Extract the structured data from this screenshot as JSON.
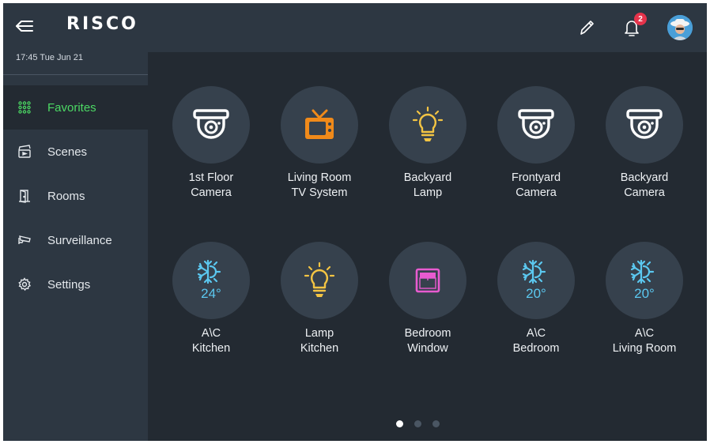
{
  "app": {
    "logo": "RISCO",
    "datetime": "17:45 Tue Jun 21"
  },
  "nav": [
    {
      "label": "Favorites",
      "icon": "favorites-grid-icon",
      "active": true
    },
    {
      "label": "Scenes",
      "icon": "clapperboard-icon"
    },
    {
      "label": "Rooms",
      "icon": "door-icon"
    },
    {
      "label": "Surveillance",
      "icon": "cctv-camera-icon"
    },
    {
      "label": "Settings",
      "icon": "gear-icon"
    }
  ],
  "topbar": {
    "notifications_count": "2"
  },
  "tiles": [
    {
      "line1": "1st Floor",
      "line2": "Camera",
      "icon": "dome-camera-icon"
    },
    {
      "line1": "Living Room",
      "line2": "TV System",
      "icon": "tv-icon"
    },
    {
      "line1": "Backyard",
      "line2": "Lamp",
      "icon": "lightbulb-icon"
    },
    {
      "line1": "Frontyard",
      "line2": "Camera",
      "icon": "dome-camera-icon"
    },
    {
      "line1": "Backyard",
      "line2": "Camera",
      "icon": "dome-camera-icon"
    },
    {
      "line1": "A\\C",
      "line2": "Kitchen",
      "icon": "ac-sun-snowflake-icon",
      "temp": "24°"
    },
    {
      "line1": "Lamp",
      "line2": "Kitchen",
      "icon": "lightbulb-icon"
    },
    {
      "line1": "Bedroom",
      "line2": "Window",
      "icon": "window-shade-icon"
    },
    {
      "line1": "A\\C",
      "line2": "Bedroom",
      "icon": "ac-sun-snowflake-icon",
      "temp": "20°"
    },
    {
      "line1": "A\\C",
      "line2": "Living Room",
      "icon": "ac-sun-snowflake-icon",
      "temp": "20°"
    }
  ],
  "pagination": {
    "pages": 3,
    "current": 1
  },
  "colors": {
    "accent_green": "#4cd964",
    "tv_orange": "#f08a1a",
    "lamp_yellow": "#f3c443",
    "window_pink": "#e85bd0",
    "ac_blue": "#5bc8f0",
    "badge_red": "#e5334b"
  }
}
